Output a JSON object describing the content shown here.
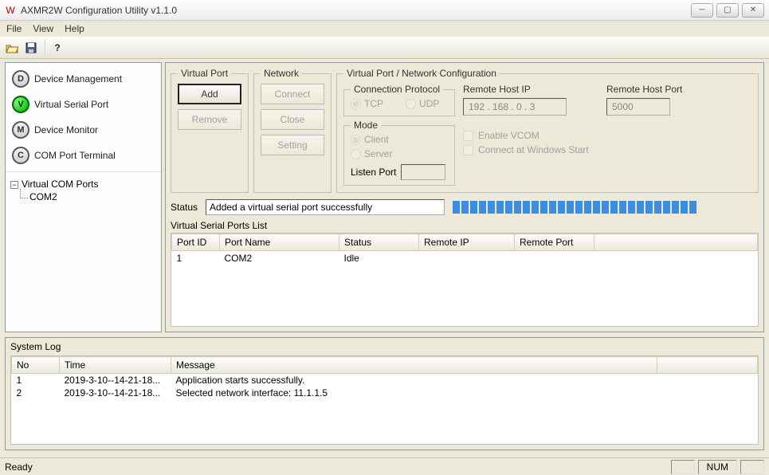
{
  "window": {
    "title": "AXMR2W Configuration Utility v1.1.0"
  },
  "menu": {
    "file": "File",
    "view": "View",
    "help": "Help"
  },
  "sidebar": {
    "items": [
      {
        "letter": "D",
        "label": "Device Management",
        "color": "gray"
      },
      {
        "letter": "V",
        "label": "Virtual Serial Port",
        "color": "green"
      },
      {
        "letter": "M",
        "label": "Device Monitor",
        "color": "gray"
      },
      {
        "letter": "C",
        "label": "COM Port Terminal",
        "color": "gray"
      }
    ],
    "tree": {
      "root": "Virtual COM Ports",
      "children": [
        "COM2"
      ]
    }
  },
  "groups": {
    "virtual_port": {
      "legend": "Virtual Port",
      "add": "Add",
      "remove": "Remove"
    },
    "network": {
      "legend": "Network",
      "connect": "Connect",
      "close": "Close",
      "setting": "Setting"
    },
    "vpnc": {
      "legend": "Virtual Port / Network Configuration",
      "conn_proto": {
        "legend": "Connection Protocol",
        "tcp": "TCP",
        "udp": "UDP"
      },
      "mode": {
        "legend": "Mode",
        "client": "Client",
        "server": "Server",
        "listen": "Listen Port"
      },
      "remote_ip": {
        "label": "Remote Host IP",
        "value": "192  .  168  .   0   .   3"
      },
      "remote_port": {
        "label": "Remote Host Port",
        "value": "5000"
      },
      "enable_vcom": "Enable VCOM",
      "connect_start": "Connect at Windows Start"
    }
  },
  "status": {
    "label": "Status",
    "text": "Added a virtual serial port successfully"
  },
  "vsp_list": {
    "label": "Virtual Serial Ports List",
    "headers": [
      "Port ID",
      "Port Name",
      "Status",
      "Remote IP",
      "Remote Port"
    ],
    "rows": [
      {
        "id": "1",
        "name": "COM2",
        "status": "Idle",
        "rip": "",
        "rport": ""
      }
    ]
  },
  "syslog": {
    "title": "System Log",
    "headers": [
      "No",
      "Time",
      "Message"
    ],
    "rows": [
      {
        "no": "1",
        "time": "2019-3-10--14-21-18...",
        "msg": "Application starts successfully."
      },
      {
        "no": "2",
        "time": "2019-3-10--14-21-18...",
        "msg": "Selected network interface: 11.1.1.5"
      }
    ]
  },
  "statusbar": {
    "ready": "Ready",
    "num": "NUM"
  }
}
